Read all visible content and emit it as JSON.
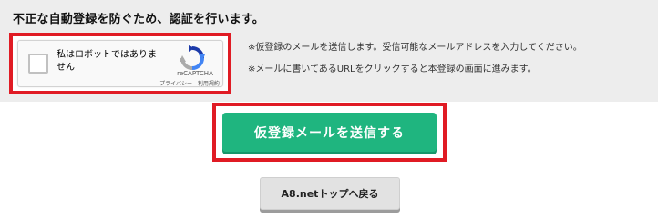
{
  "verification": {
    "heading": "不正な自動登録を防ぐため、認証を行います。",
    "captcha": {
      "checkbox_label": "私はロボットではありません",
      "brand": "reCAPTCHA",
      "links": "プライバシー - 利用規約",
      "icon": "recaptcha-logo-icon",
      "checked": false
    },
    "notes": [
      "※仮登録のメールを送信します。受信可能なメールアドレスを入力してください。",
      "※メールに書いてあるURLをクリックすると本登録の画面に進みます。"
    ]
  },
  "actions": {
    "submit_label": "仮登録メールを送信する",
    "back_label": "A8.netトップへ戻る"
  },
  "colors": {
    "panel_bg": "#ededed",
    "highlight_border": "#e01b24",
    "submit_bg": "#1fb57f",
    "back_bg": "#e2e2e2"
  }
}
